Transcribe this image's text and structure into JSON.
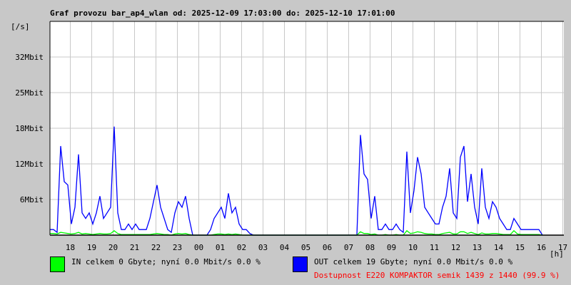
{
  "chart_data": {
    "type": "line",
    "title": "Graf provozu bar_ap4_wlan od: 2025-12-09 17:03:00 do: 2025-12-10 17:01:00",
    "ylabel": "[/s]",
    "xlabel": "[h]",
    "ylim": [
      0,
      38.4
    ],
    "y_ticks": [
      {
        "v": 6.4,
        "label": "6Mbit"
      },
      {
        "v": 12.8,
        "label": "12Mbit"
      },
      {
        "v": 19.2,
        "label": "18Mbit"
      },
      {
        "v": 25.6,
        "label": "25Mbit"
      },
      {
        "v": 32,
        "label": "32Mbit"
      }
    ],
    "x_tick_labels": [
      "18",
      "19",
      "20",
      "21",
      "22",
      "23",
      "00",
      "01",
      "02",
      "03",
      "04",
      "05",
      "06",
      "07",
      "08",
      "09",
      "10",
      "11",
      "12",
      "13",
      "14",
      "15",
      "16",
      "17"
    ],
    "x_start_minutes": 3,
    "sample_minutes": 10,
    "grid": true,
    "series": [
      {
        "name": "OUT",
        "color": "#0000ff",
        "values": [
          1,
          1,
          0.5,
          16,
          9.6,
          9,
          2,
          5,
          14.5,
          4,
          3,
          4,
          2,
          4,
          7,
          3,
          4,
          5,
          19.5,
          4,
          1,
          1,
          2,
          1,
          2,
          1,
          1,
          1,
          3,
          6,
          9,
          5,
          3,
          1,
          0.5,
          4,
          6,
          5,
          7,
          3,
          0,
          0,
          0,
          0,
          0,
          1,
          3,
          4,
          5,
          3,
          7.5,
          4,
          5,
          2,
          1,
          1,
          0.3,
          0,
          0,
          0,
          0,
          0,
          0,
          0,
          0,
          0,
          0,
          0,
          0,
          0,
          0,
          0,
          0,
          0,
          0,
          0,
          0,
          0,
          0,
          0,
          0,
          0,
          0,
          0,
          0,
          0,
          0,
          18,
          11,
          10,
          3,
          7,
          1,
          1,
          2,
          1,
          1,
          2,
          1,
          0.5,
          15,
          4,
          8,
          14,
          11,
          5,
          4,
          3,
          2,
          2,
          5,
          7,
          12,
          4,
          3,
          14,
          16,
          6,
          11,
          5,
          2,
          12,
          5,
          3,
          6,
          5,
          3,
          2,
          1,
          1,
          3,
          2,
          1,
          1,
          1,
          1,
          1,
          1,
          0
        ]
      },
      {
        "name": "IN",
        "color": "#00ff00",
        "values": [
          0.3,
          0.3,
          0.2,
          0.5,
          0.4,
          0.3,
          0.2,
          0.3,
          0.5,
          0.2,
          0.3,
          0.2,
          0.1,
          0.2,
          0.3,
          0.2,
          0.2,
          0.3,
          0.8,
          0.3,
          0.1,
          0.1,
          0.1,
          0.1,
          0.1,
          0.1,
          0.1,
          0.1,
          0.1,
          0.2,
          0.3,
          0.2,
          0.1,
          0.1,
          0,
          0.2,
          0.3,
          0.2,
          0.3,
          0.1,
          0,
          0,
          0,
          0,
          0,
          0,
          0.1,
          0.2,
          0.2,
          0.1,
          0.2,
          0.1,
          0.2,
          0.1,
          0,
          0,
          0,
          0,
          0,
          0,
          0,
          0,
          0,
          0,
          0,
          0,
          0,
          0,
          0,
          0,
          0,
          0,
          0,
          0,
          0,
          0,
          0,
          0,
          0,
          0,
          0,
          0,
          0,
          0,
          0,
          0,
          0,
          0.6,
          0.3,
          0.3,
          0.1,
          0.2,
          0,
          0,
          0.1,
          0,
          0,
          0.1,
          0,
          0,
          0.8,
          0.3,
          0.4,
          0.6,
          0.5,
          0.3,
          0.2,
          0.2,
          0.1,
          0.1,
          0.3,
          0.4,
          0.5,
          0.2,
          0.2,
          0.6,
          0.6,
          0.3,
          0.5,
          0.3,
          0.1,
          0.4,
          0.2,
          0.2,
          0.3,
          0.3,
          0.2,
          0.1,
          0.1,
          0.1,
          0.8,
          0.2,
          0.1,
          0.1,
          0.1,
          0.1,
          0.1,
          0.1,
          0
        ]
      }
    ]
  },
  "legend": {
    "in_label": "IN celkem 0 Gbyte; nyní   0.0 Mbit/s 0.0 %",
    "out_label": "OUT celkem 19 Gbyte; nyní   0.0 Mbit/s 0.0 %",
    "availability": "Dostupnost E220 KOMPAKTOR semik 1439 z 1440 (99.9 %)",
    "in_color": "#00ff00",
    "out_color": "#0000ff",
    "availability_color": "#ff0000"
  }
}
